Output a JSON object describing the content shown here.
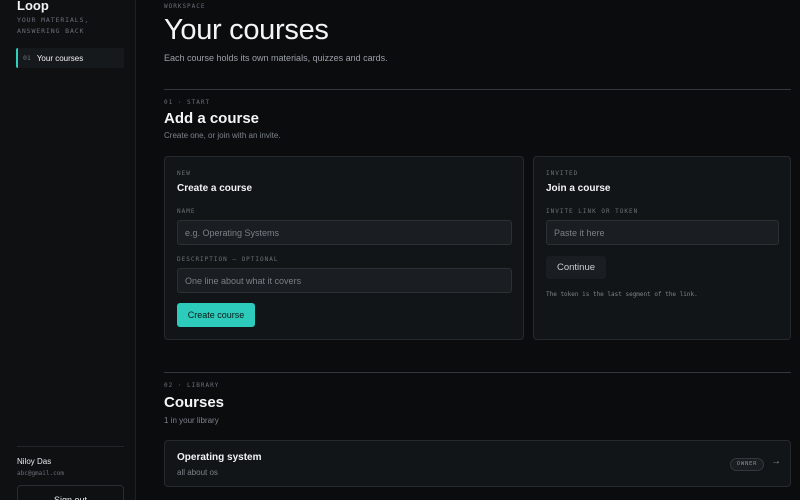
{
  "sidebar": {
    "brand": "Loop",
    "tagline_line1": "YOUR MATERIALS,",
    "tagline_line2": "ANSWERING BACK",
    "nav": [
      {
        "num": "01",
        "label": "Your courses"
      }
    ],
    "user": {
      "name": "Niloy Das",
      "email": "abc@gmail.com"
    },
    "sign_out_label": "Sign out"
  },
  "header": {
    "eyebrow": "WORKSPACE",
    "title": "Your courses",
    "subtitle": "Each course holds its own materials, quizzes and cards."
  },
  "add_section": {
    "eyebrow": "01 · START",
    "title": "Add a course",
    "subtitle": "Create one, or join with an invite."
  },
  "create_card": {
    "eyebrow": "NEW",
    "title": "Create a course",
    "name_label": "NAME",
    "name_placeholder": "e.g. Operating Systems",
    "name_value": "",
    "description_label": "DESCRIPTION — OPTIONAL",
    "description_placeholder": "One line about what it covers",
    "description_value": "",
    "submit_label": "Create course"
  },
  "join_card": {
    "eyebrow": "INVITED",
    "title": "Join a course",
    "token_label": "INVITE LINK OR TOKEN",
    "token_placeholder": "Paste it here",
    "token_value": "",
    "continue_label": "Continue",
    "hint": "The token is the last segment of the link."
  },
  "library_section": {
    "eyebrow": "02 · LIBRARY",
    "title": "Courses",
    "subtitle": "1 in your library"
  },
  "courses": [
    {
      "name": "Operating system",
      "description": "all about os",
      "role": "OWNER",
      "arrow": "→"
    }
  ],
  "colors": {
    "background": "#0b0c0e",
    "sidebar": "#0e1012",
    "card": "#121517",
    "accent": "#2dcbbb"
  }
}
